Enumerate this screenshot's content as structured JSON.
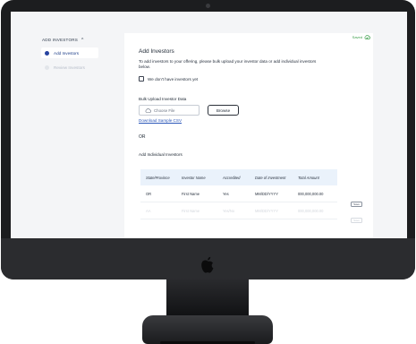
{
  "sidebar": {
    "section_label": "ADD INVESTORS",
    "section_chevron": "^",
    "steps": [
      {
        "label": "Add Investors",
        "state": "active"
      },
      {
        "label": "Review Investors",
        "state": "inactive"
      }
    ]
  },
  "status": {
    "saved_label": "Saved",
    "icon": "cloud-check-icon",
    "color": "#3a9d4a"
  },
  "page": {
    "title": "Add Investors",
    "description": "To add investors to your offering, please bulk upload your investor data or add individual investors below.",
    "no_investors_label": "We don't have investors yet",
    "bulk_upload_title": "Bulk Upload Investor Data",
    "file_placeholder": "Choose File",
    "browse_label": "Browse",
    "sample_link": "Download Sample CSV",
    "or_label": "OR",
    "individual_title": "Add Individual Investors"
  },
  "table": {
    "headers": [
      "State/Province",
      "Investor Name",
      "Accredited",
      "Date of Investment",
      "Total Amount"
    ],
    "rows": [
      {
        "cells": [
          "OR",
          "First Name",
          "Yes",
          "MM/DD/YYYY",
          "000,000,000.00"
        ],
        "action": "Save",
        "faded": false
      },
      {
        "cells": [
          "AA",
          "First Name",
          "Yes/No",
          "MM/DD/YYYY",
          "000,000,000.00"
        ],
        "action": "Save",
        "faded": true
      }
    ]
  },
  "colors": {
    "accent": "#2743a0",
    "link": "#2a56b8",
    "table_header_bg": "#eaf2fb"
  }
}
